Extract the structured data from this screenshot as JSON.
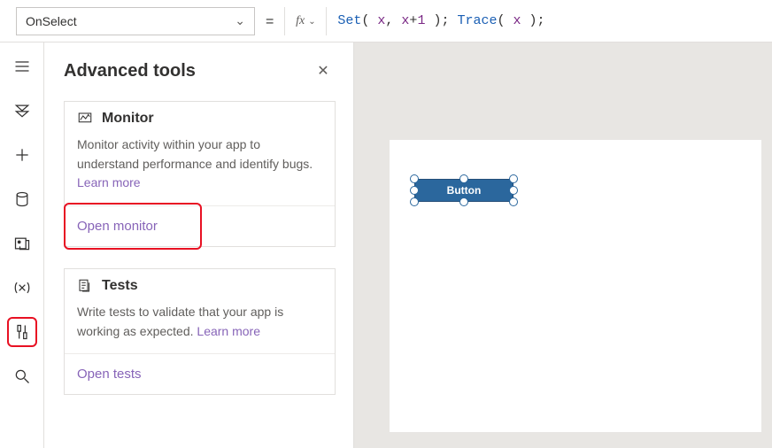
{
  "property_selector": {
    "value": "OnSelect"
  },
  "formula": {
    "tokens": [
      {
        "t": "fn",
        "v": "Set"
      },
      {
        "t": "plain",
        "v": "( "
      },
      {
        "t": "ident",
        "v": "x"
      },
      {
        "t": "plain",
        "v": ", "
      },
      {
        "t": "ident",
        "v": "x"
      },
      {
        "t": "plain",
        "v": "+"
      },
      {
        "t": "num",
        "v": "1"
      },
      {
        "t": "plain",
        "v": " ); "
      },
      {
        "t": "fn",
        "v": "Trace"
      },
      {
        "t": "plain",
        "v": "( "
      },
      {
        "t": "ident",
        "v": "x"
      },
      {
        "t": "plain",
        "v": " );"
      }
    ]
  },
  "panel": {
    "title": "Advanced tools",
    "close_label": "✕"
  },
  "monitor_card": {
    "title": "Monitor",
    "body": "Monitor activity within your app to understand performance and identify bugs. ",
    "learn_more": "Learn more",
    "action": "Open monitor"
  },
  "tests_card": {
    "title": "Tests",
    "body": "Write tests to validate that your app is working as expected. ",
    "learn_more": "Learn more",
    "action": "Open tests"
  },
  "canvas": {
    "button_label": "Button"
  }
}
